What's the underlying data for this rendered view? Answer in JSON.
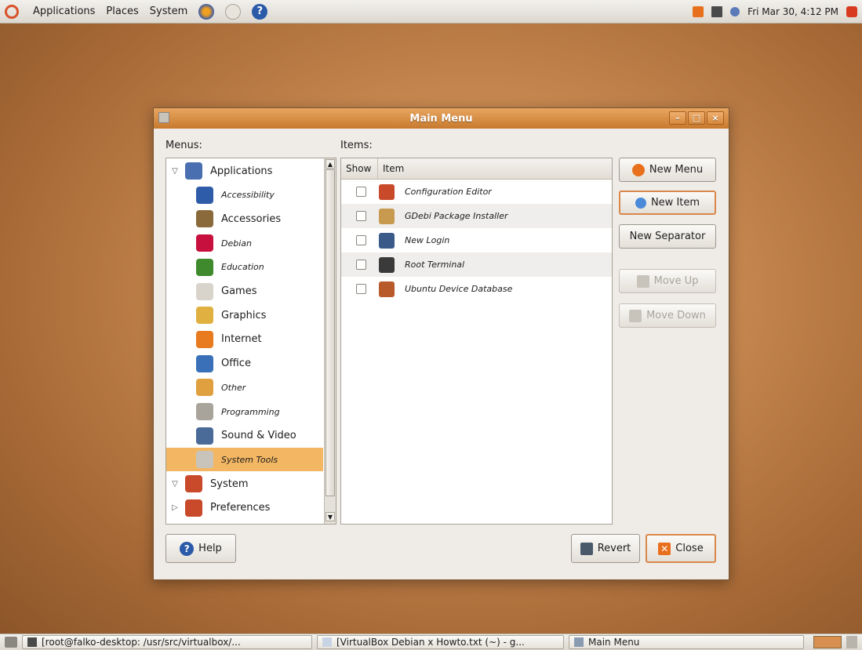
{
  "top_panel": {
    "menus": [
      "Applications",
      "Places",
      "System"
    ],
    "clock": "Fri Mar 30,  4:12 PM"
  },
  "window": {
    "title": "Main Menu",
    "menus_label": "Menus:",
    "items_label": "Items:",
    "tree": [
      {
        "label": "Applications",
        "level": 0,
        "expander": "▽",
        "icon": "applications-icon",
        "color": "#4a6fb0",
        "italic": false
      },
      {
        "label": "Accessibility",
        "level": 1,
        "icon": "accessibility-icon",
        "color": "#2f5ca8",
        "italic": true
      },
      {
        "label": "Accessories",
        "level": 1,
        "icon": "accessories-icon",
        "color": "#8a6a3a",
        "italic": false
      },
      {
        "label": "Debian",
        "level": 1,
        "icon": "debian-icon",
        "color": "#c8103e",
        "italic": true
      },
      {
        "label": "Education",
        "level": 1,
        "icon": "education-icon",
        "color": "#3e8a2c",
        "italic": true
      },
      {
        "label": "Games",
        "level": 1,
        "icon": "games-icon",
        "color": "#d8d4cc",
        "italic": false
      },
      {
        "label": "Graphics",
        "level": 1,
        "icon": "graphics-icon",
        "color": "#e0b040",
        "italic": false
      },
      {
        "label": "Internet",
        "level": 1,
        "icon": "internet-icon",
        "color": "#e87a20",
        "italic": false
      },
      {
        "label": "Office",
        "level": 1,
        "icon": "office-icon",
        "color": "#3a70b8",
        "italic": false
      },
      {
        "label": "Other",
        "level": 1,
        "icon": "other-icon",
        "color": "#e0a040",
        "italic": true
      },
      {
        "label": "Programming",
        "level": 1,
        "icon": "programming-icon",
        "color": "#a8a49c",
        "italic": true
      },
      {
        "label": "Sound & Video",
        "level": 1,
        "icon": "sound-video-icon",
        "color": "#4a6a98",
        "italic": false
      },
      {
        "label": "System Tools",
        "level": 1,
        "icon": "system-tools-icon",
        "color": "#c8c4bc",
        "italic": true,
        "selected": true
      },
      {
        "label": "System",
        "level": 0,
        "expander": "▽",
        "icon": "system-icon",
        "color": "#c84a2a",
        "italic": false
      },
      {
        "label": "Preferences",
        "level": 0,
        "expander": "▷",
        "icon": "preferences-icon",
        "color": "#c84a2a",
        "italic": false
      }
    ],
    "items_columns": {
      "show": "Show",
      "item": "Item"
    },
    "items": [
      {
        "label": "Configuration Editor",
        "icon": "configuration-editor-icon",
        "color": "#c84a2a"
      },
      {
        "label": "GDebi Package Installer",
        "icon": "package-installer-icon",
        "color": "#c89a50"
      },
      {
        "label": "New Login",
        "icon": "new-login-icon",
        "color": "#3a5a8a"
      },
      {
        "label": "Root Terminal",
        "icon": "terminal-icon",
        "color": "#3a3a3a"
      },
      {
        "label": "Ubuntu Device Database",
        "icon": "device-database-icon",
        "color": "#b85a2a"
      }
    ],
    "buttons": {
      "new_menu": "New Menu",
      "new_item": "New Item",
      "new_separator": "New Separator",
      "move_up": "Move Up",
      "move_down": "Move Down",
      "help": "Help",
      "revert": "Revert",
      "close": "Close"
    }
  },
  "taskbar": {
    "tasks": [
      "[root@falko-desktop: /usr/src/virtualbox/...",
      "[VirtualBox Debian x Howto.txt (~) - g...",
      "Main Menu"
    ]
  }
}
